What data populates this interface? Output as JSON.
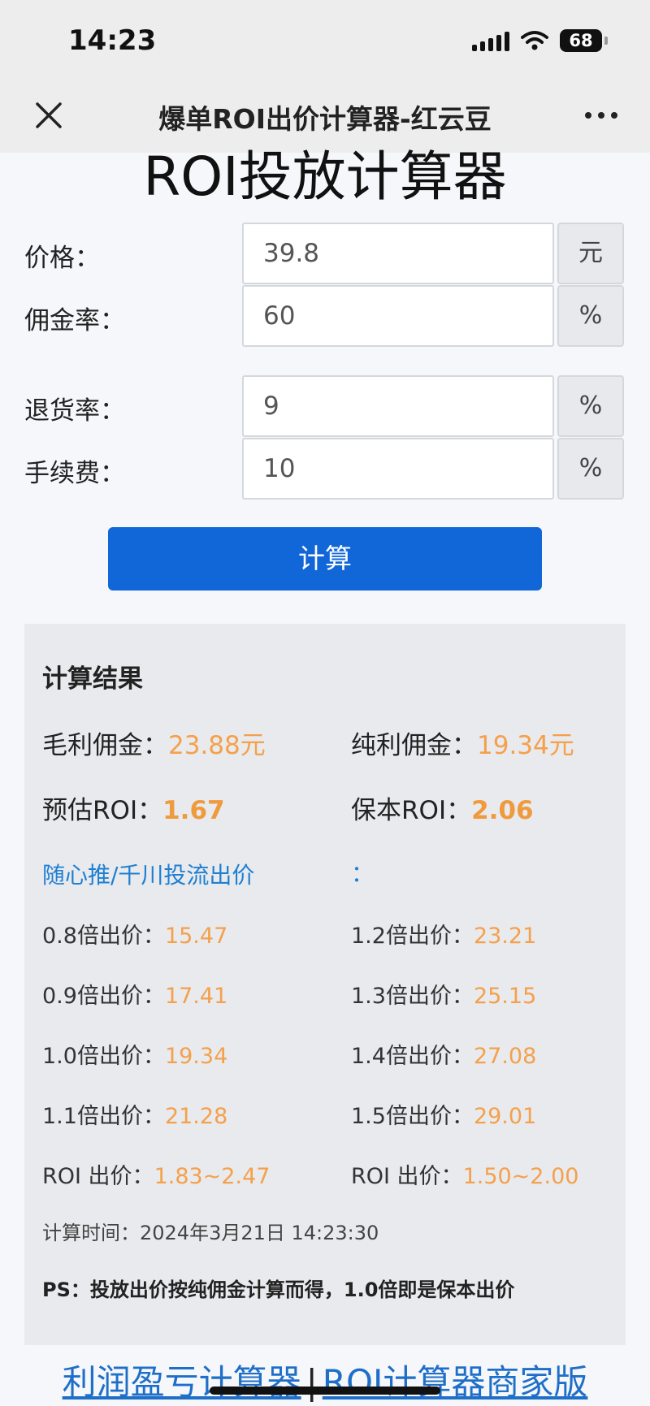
{
  "status": {
    "time": "14:23",
    "battery": "68"
  },
  "nav": {
    "title": "爆单ROI出价计算器-红云豆"
  },
  "main": {
    "title": "ROI投放计算器"
  },
  "form": {
    "price": {
      "label": "价格：",
      "value": "39.8",
      "unit": "元"
    },
    "commission": {
      "label": "佣金率：",
      "value": "60",
      "unit": "%"
    },
    "return_rate": {
      "label": "退货率：",
      "value": "9",
      "unit": "%"
    },
    "fee": {
      "label": "手续费：",
      "value": "10",
      "unit": "%"
    },
    "calc_button": "计算"
  },
  "result": {
    "heading": "计算结果",
    "gross_commission": {
      "label": "毛利佣金：",
      "value": "23.88元"
    },
    "net_commission": {
      "label": "纯利佣金：",
      "value": "19.34元"
    },
    "est_roi": {
      "label": "预估ROI：",
      "value": "1.67"
    },
    "breakeven_roi": {
      "label": "保本ROI：",
      "value": "2.06"
    },
    "bid_link": "随心推/千川投流出价",
    "bid_colon": "：",
    "bids_left": [
      {
        "label": "0.8倍出价：",
        "value": "15.47"
      },
      {
        "label": "0.9倍出价：",
        "value": "17.41"
      },
      {
        "label": "1.0倍出价：",
        "value": "19.34"
      },
      {
        "label": "1.1倍出价：",
        "value": "21.28"
      },
      {
        "label": "ROI 出价：",
        "value": "1.83~2.47"
      }
    ],
    "bids_right": [
      {
        "label": "1.2倍出价：",
        "value": "23.21"
      },
      {
        "label": "1.3倍出价：",
        "value": "25.15"
      },
      {
        "label": "1.4倍出价：",
        "value": "27.08"
      },
      {
        "label": "1.5倍出价：",
        "value": "29.01"
      },
      {
        "label": "ROI 出价：",
        "value": "1.50~2.00"
      }
    ],
    "calc_time": "计算时间：2024年3月21日 14:23:30",
    "ps": "PS：投放出价按纯佣金计算而得，1.0倍即是保本出价"
  },
  "footer": {
    "link_profit": "利润盈亏计算器",
    "separator": "|",
    "link_merchant": "ROI计算器商家版"
  },
  "colors": {
    "accent": "#1167d8",
    "value": "#f5a04b",
    "link": "#1f7fd2"
  }
}
